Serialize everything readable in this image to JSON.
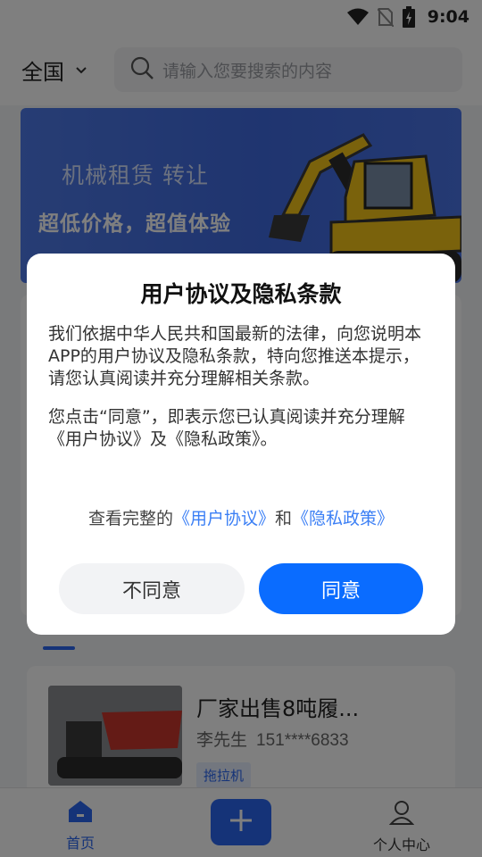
{
  "status_bar": {
    "time": "9:04"
  },
  "header": {
    "region": "全国",
    "search_placeholder": "请输入您要搜索的内容"
  },
  "banner": {
    "title": "机械租赁 转让",
    "subtitle": "超低价格，超值体验"
  },
  "tabs": [
    {
      "label": ""
    },
    {
      "label": ""
    },
    {
      "label": ""
    },
    {
      "label": ""
    }
  ],
  "listing": {
    "title": "厂家出售8吨履...",
    "contact_name": "李先生",
    "phone": "151****6833",
    "tag": "拖拉机"
  },
  "bottom_nav": {
    "home_label": "首页",
    "user_label": "个人中心"
  },
  "dialog": {
    "title": "用户协议及隐私条款",
    "paragraph1": "我们依据中华人民共和国最新的法律，向您说明本APP的用户协议及隐私条款，特向您推送本提示，请您认真阅读并充分理解相关条款。",
    "paragraph2": "您点击“同意”，即表示您已认真阅读并充分理解《用户协议》及《隐私政策》。",
    "links_prefix": "查看完整的",
    "user_agreement_link": "《用户协议》",
    "links_and": "和",
    "privacy_policy_link": "《隐私政策》",
    "disagree_label": "不同意",
    "agree_label": "同意"
  },
  "colors": {
    "primary": "#0a6cff",
    "link": "#3b7ff5",
    "overlay": "rgba(0,0,0,0.5)"
  }
}
